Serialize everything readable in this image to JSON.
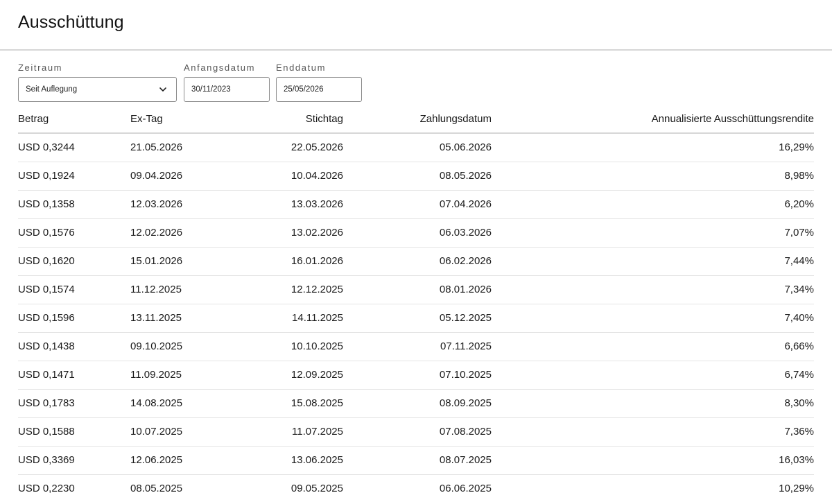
{
  "page": {
    "title": "Ausschüttung"
  },
  "filters": {
    "zeitraum": {
      "label": "Zeitraum",
      "value": "Seit Auflegung"
    },
    "start": {
      "label": "Anfangsdatum",
      "value": "30/11/2023"
    },
    "end": {
      "label": "Enddatum",
      "value": "25/05/2026"
    }
  },
  "table": {
    "headers": [
      "Betrag",
      "Ex-Tag",
      "Stichtag",
      "Zahlungsdatum",
      "Annualisierte Ausschüttungsrendite"
    ],
    "rows": [
      [
        "USD 0,3244",
        "21.05.2026",
        "22.05.2026",
        "05.06.2026",
        "16,29%"
      ],
      [
        "USD 0,1924",
        "09.04.2026",
        "10.04.2026",
        "08.05.2026",
        "8,98%"
      ],
      [
        "USD 0,1358",
        "12.03.2026",
        "13.03.2026",
        "07.04.2026",
        "6,20%"
      ],
      [
        "USD 0,1576",
        "12.02.2026",
        "13.02.2026",
        "06.03.2026",
        "7,07%"
      ],
      [
        "USD 0,1620",
        "15.01.2026",
        "16.01.2026",
        "06.02.2026",
        "7,44%"
      ],
      [
        "USD 0,1574",
        "11.12.2025",
        "12.12.2025",
        "08.01.2026",
        "7,34%"
      ],
      [
        "USD 0,1596",
        "13.11.2025",
        "14.11.2025",
        "05.12.2025",
        "7,40%"
      ],
      [
        "USD 0,1438",
        "09.10.2025",
        "10.10.2025",
        "07.11.2025",
        "6,66%"
      ],
      [
        "USD 0,1471",
        "11.09.2025",
        "12.09.2025",
        "07.10.2025",
        "6,74%"
      ],
      [
        "USD 0,1783",
        "14.08.2025",
        "15.08.2025",
        "08.09.2025",
        "8,30%"
      ],
      [
        "USD 0,1588",
        "10.07.2025",
        "11.07.2025",
        "07.08.2025",
        "7,36%"
      ],
      [
        "USD 0,3369",
        "12.06.2025",
        "13.06.2025",
        "08.07.2025",
        "16,03%"
      ],
      [
        "USD 0,2230",
        "08.05.2025",
        "09.05.2025",
        "06.06.2025",
        "10,29%"
      ]
    ]
  }
}
